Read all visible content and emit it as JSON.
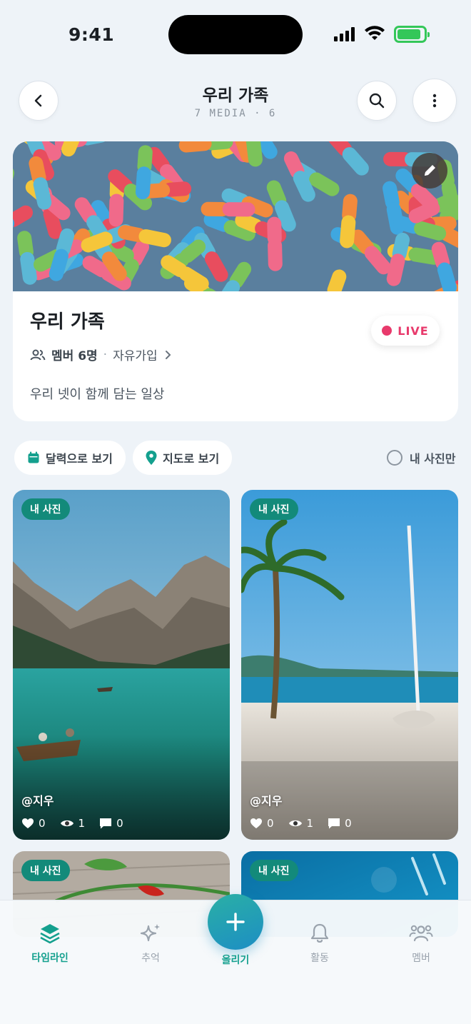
{
  "status_bar": {
    "time": "9:41"
  },
  "header": {
    "title": "우리 가족",
    "subtitle": "7 MEDIA · 6",
    "back_icon": "chevron-left-icon",
    "search_icon": "search-icon",
    "more_icon": "more-vertical-icon"
  },
  "album": {
    "name": "우리 가족",
    "members_label": "멤버 6명",
    "join_type": "자유가입",
    "description": "우리 넷이 함께 담는 일상",
    "live_label": "LIVE"
  },
  "filters": {
    "calendar_label": "달력으로 보기",
    "map_label": "지도로 보기",
    "mine_only_label": "내 사진만"
  },
  "posts": [
    {
      "badge": "내 사진",
      "author": "@지우",
      "likes": "0",
      "views": "1",
      "comments": "0",
      "scene": "mountain-lake"
    },
    {
      "badge": "내 사진",
      "author": "@지우",
      "likes": "0",
      "views": "1",
      "comments": "0",
      "scene": "palm-beach"
    },
    {
      "badge": "내 사진",
      "scene": "herbs-table"
    },
    {
      "badge": "내 사진",
      "scene": "blue-water"
    }
  ],
  "nav": {
    "timeline": "타임라인",
    "memories": "추억",
    "upload": "올리기",
    "activity": "활동",
    "members": "멤버"
  },
  "colors": {
    "accent": "#14a08e",
    "badge": "#138a7a",
    "live": "#e83a6c",
    "background": "#eef3f8"
  }
}
